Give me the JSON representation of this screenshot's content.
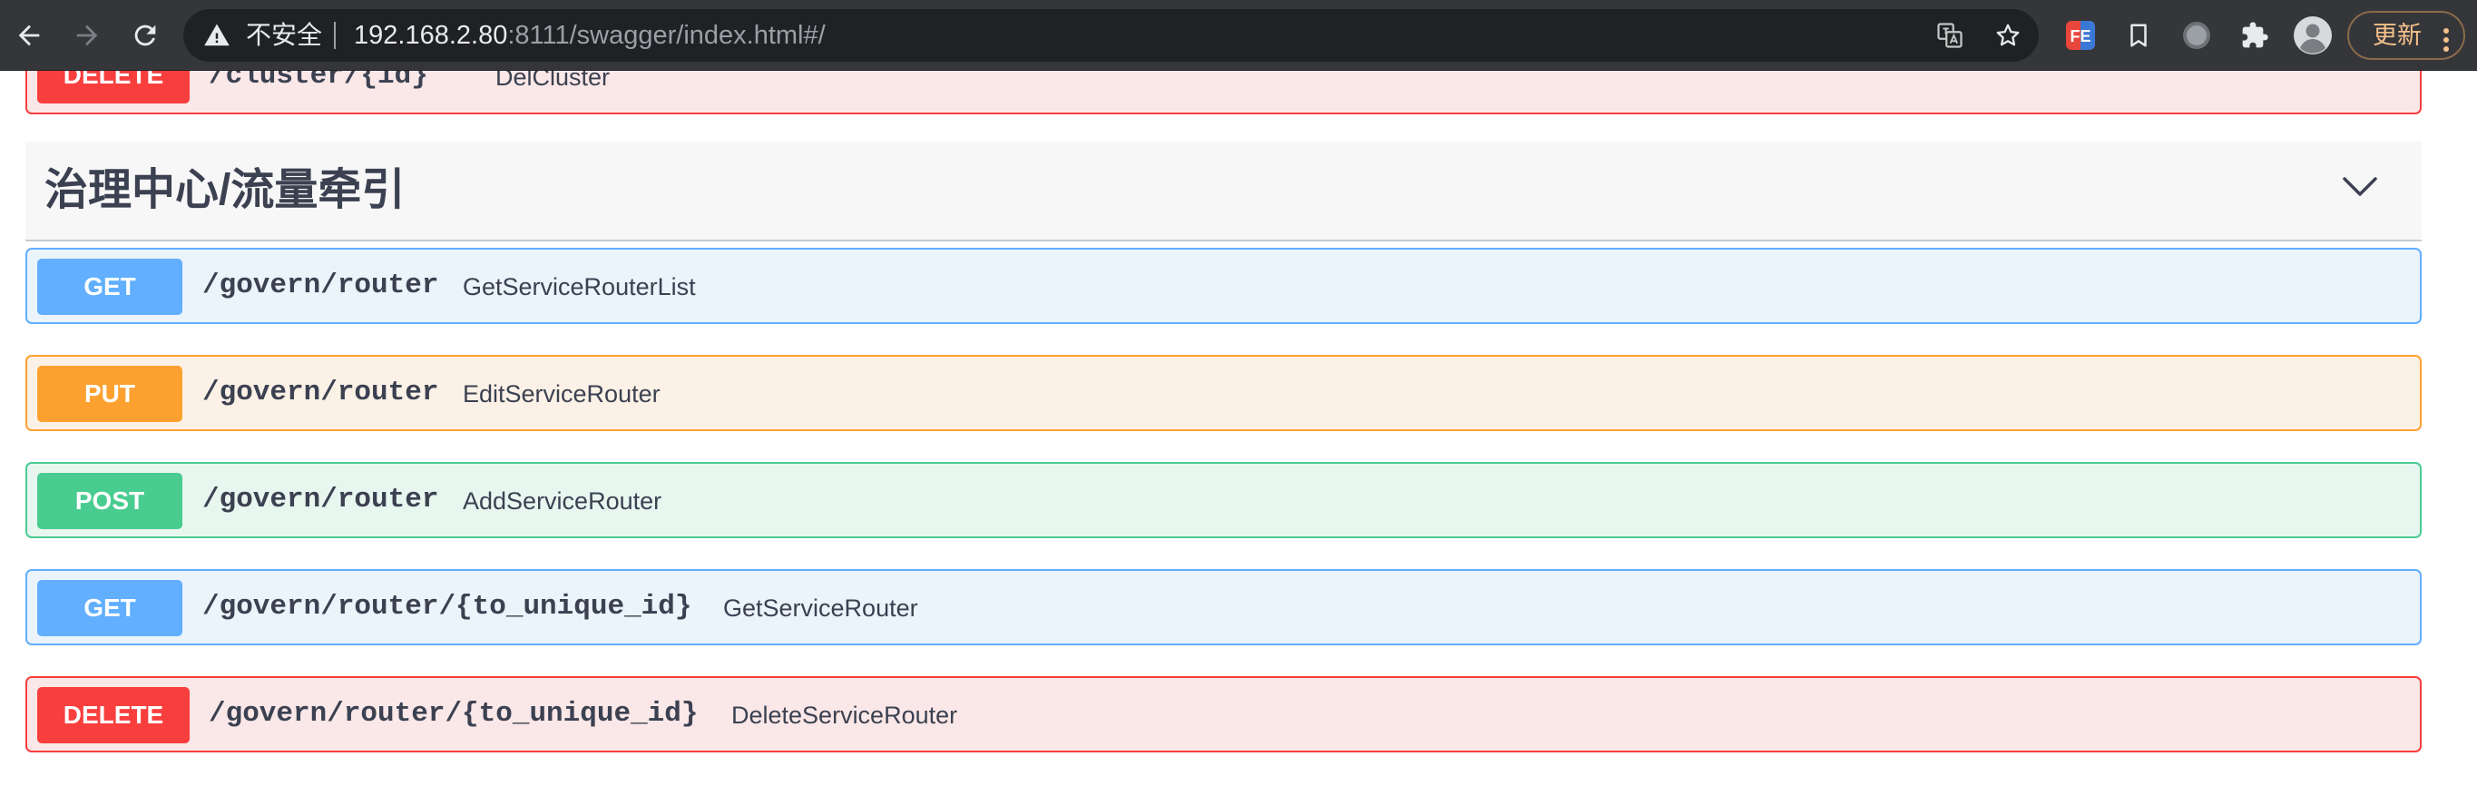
{
  "browser": {
    "security_label": "不安全",
    "url_host": "192.168.2.80",
    "url_rest": ":8111/swagger/index.html#/",
    "update_label": "更新",
    "extension_label": "FE",
    "icons": [
      "back-arrow-icon",
      "forward-arrow-icon",
      "reload-icon",
      "warning-icon",
      "translate-icon",
      "star-icon",
      "fe-extension-icon",
      "bookmark-icon",
      "record-icon",
      "puzzle-icon",
      "profile-avatar-icon",
      "menu-dots-icon"
    ],
    "colors": {
      "toolbar": "#35363a",
      "omnibox": "#202124",
      "update_accent": "#f6c28b"
    }
  },
  "partial_operation": {
    "method": "DELETE",
    "path": "/cluster/{id}",
    "summary": "DelCluster"
  },
  "section": {
    "title": "治理中心/流量牵引",
    "expanded": true
  },
  "operations": [
    {
      "method": "GET",
      "path": "/govern/router",
      "summary": "GetServiceRouterList"
    },
    {
      "method": "PUT",
      "path": "/govern/router",
      "summary": "EditServiceRouter"
    },
    {
      "method": "POST",
      "path": "/govern/router",
      "summary": "AddServiceRouter"
    },
    {
      "method": "GET",
      "path": "/govern/router/{to_unique_id}",
      "summary": "GetServiceRouter"
    },
    {
      "method": "DELETE",
      "path": "/govern/router/{to_unique_id}",
      "summary": "DeleteServiceRouter"
    }
  ],
  "method_colors": {
    "GET": "#61affe",
    "PUT": "#fca130",
    "POST": "#49cc90",
    "DELETE": "#f93e3e"
  }
}
